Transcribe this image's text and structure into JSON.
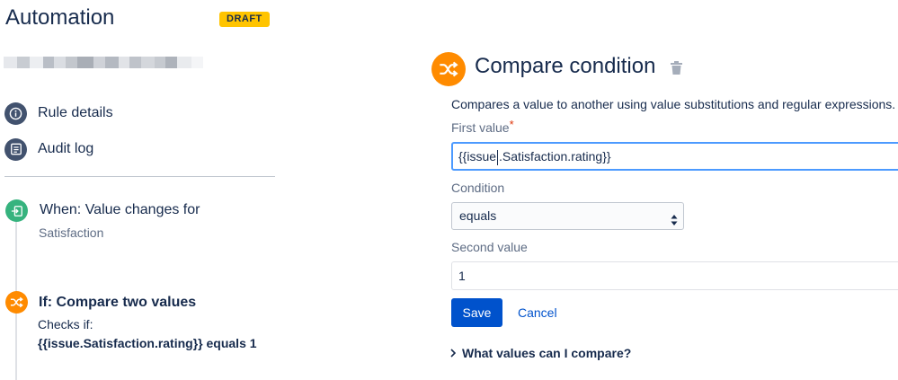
{
  "header": {
    "title": "Automation",
    "badge": "DRAFT"
  },
  "nav": {
    "items": [
      {
        "label": "Rule details",
        "icon": "info-icon"
      },
      {
        "label": "Audit log",
        "icon": "list-icon"
      }
    ]
  },
  "steps": [
    {
      "title": "When: Value changes for",
      "subtitle": "Satisfaction",
      "icon": "trigger-icon",
      "color": "#36b37e"
    },
    {
      "title": "If: Compare two values",
      "line1": "Checks if:",
      "line2": "{{issue.Satisfaction.rating}} equals 1",
      "icon": "shuffle-icon",
      "color": "#ff8b00"
    }
  ],
  "panel": {
    "title": "Compare condition",
    "description": "Compares a value to another using value substitutions and regular expressions.",
    "first_value_label": "First value",
    "required_mark": "*",
    "first_value_before_caret": "{{issue",
    "first_value_after_caret": ".Satisfaction.rating}}",
    "condition_label": "Condition",
    "condition_selected": "equals",
    "second_value_label": "Second value",
    "second_value": "1",
    "save_label": "Save",
    "cancel_label": "Cancel",
    "help_toggle": "What values can I compare?"
  },
  "colors": {
    "accent": "#0052cc",
    "badge": "#ffc400",
    "condition_orange": "#ff8b00",
    "trigger_green": "#36b37e",
    "focus_border": "#4c9aff"
  }
}
